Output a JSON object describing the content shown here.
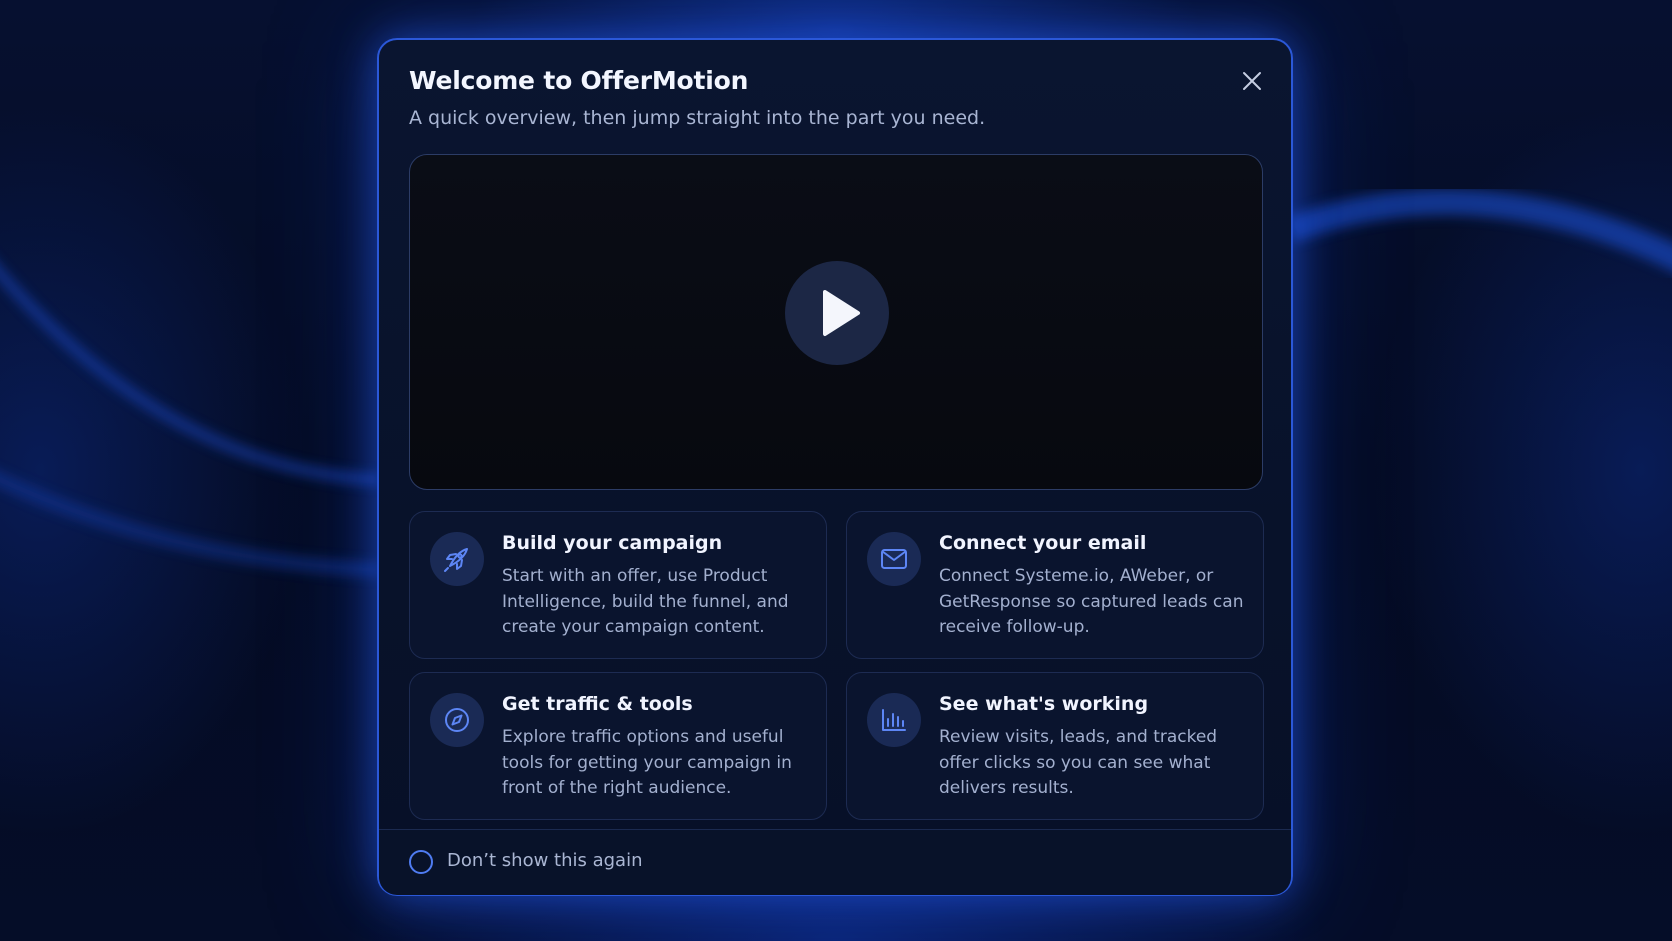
{
  "modal": {
    "title": "Welcome to OfferMotion",
    "subtitle": "A quick overview, then jump straight into the part you need."
  },
  "video": {
    "play_icon": "play-icon"
  },
  "cards": [
    {
      "title": "Build your campaign",
      "description": "Start with an offer, use Product Intelligence, build the funnel, and create your campaign content.",
      "icon": "rocket-icon"
    },
    {
      "title": "Connect your email",
      "description": "Connect Systeme.io, AWeber, or GetResponse so captured leads can receive follow-up.",
      "icon": "mail-icon"
    },
    {
      "title": "Get traffic & tools",
      "description": "Explore traffic options and useful tools for getting your campaign in front of the right audience.",
      "icon": "compass-icon"
    },
    {
      "title": "See what's working",
      "description": "Review visits, leads, and tracked offer clicks so you can see what delivers results.",
      "icon": "bar-chart-icon"
    }
  ],
  "footer": {
    "checkbox_label": "Don’t show this again",
    "checked": false
  },
  "colors": {
    "accent": "#4f7cf2",
    "modal_border": "#2b58d8",
    "background": "#040a1c"
  }
}
